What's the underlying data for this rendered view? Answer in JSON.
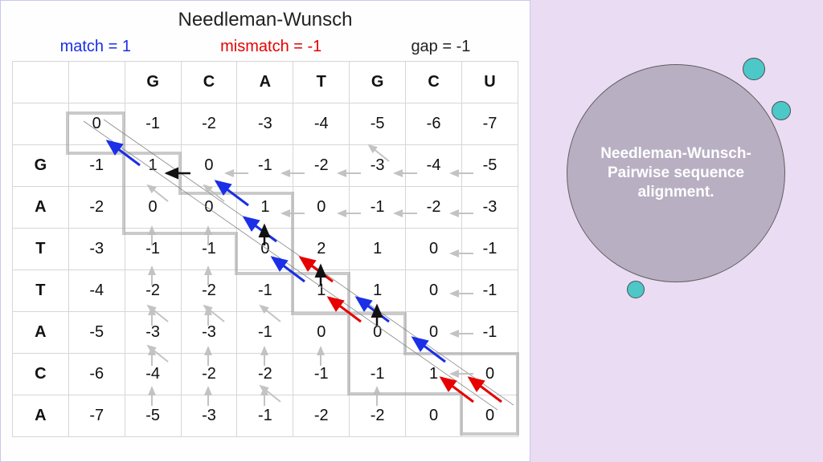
{
  "title": "Needleman-Wunsch",
  "legend": {
    "match": "match = 1",
    "mismatch": "mismatch = -1",
    "gap": "gap = -1"
  },
  "side_label": "Needleman-Wunsch-Pairwise sequence alignment.",
  "chart_data": {
    "type": "table",
    "description": "Needleman-Wunsch dynamic programming scoring matrix aligning GATTACA (rows) against GCATGCU (columns). First score row/column are gap penalties; path highlighted diagonally.",
    "col_seq": [
      "G",
      "C",
      "A",
      "T",
      "G",
      "C",
      "U"
    ],
    "row_seq": [
      "G",
      "A",
      "T",
      "T",
      "A",
      "C",
      "A"
    ],
    "scores": [
      [
        0,
        -1,
        -2,
        -3,
        -4,
        -5,
        -6,
        -7
      ],
      [
        -1,
        1,
        0,
        -1,
        -2,
        -3,
        -4,
        -5
      ],
      [
        -2,
        0,
        0,
        1,
        0,
        -1,
        -2,
        -3
      ],
      [
        -3,
        -1,
        -1,
        0,
        2,
        1,
        0,
        -1
      ],
      [
        -4,
        -2,
        -2,
        -1,
        1,
        1,
        0,
        -1
      ],
      [
        -5,
        -3,
        -3,
        -1,
        0,
        0,
        0,
        -1
      ],
      [
        -6,
        -4,
        -2,
        -2,
        -1,
        -1,
        1,
        0
      ],
      [
        -7,
        -5,
        -3,
        -1,
        -2,
        -2,
        0,
        0
      ]
    ],
    "match_score": 1,
    "mismatch_score": -1,
    "gap_score": -1
  }
}
